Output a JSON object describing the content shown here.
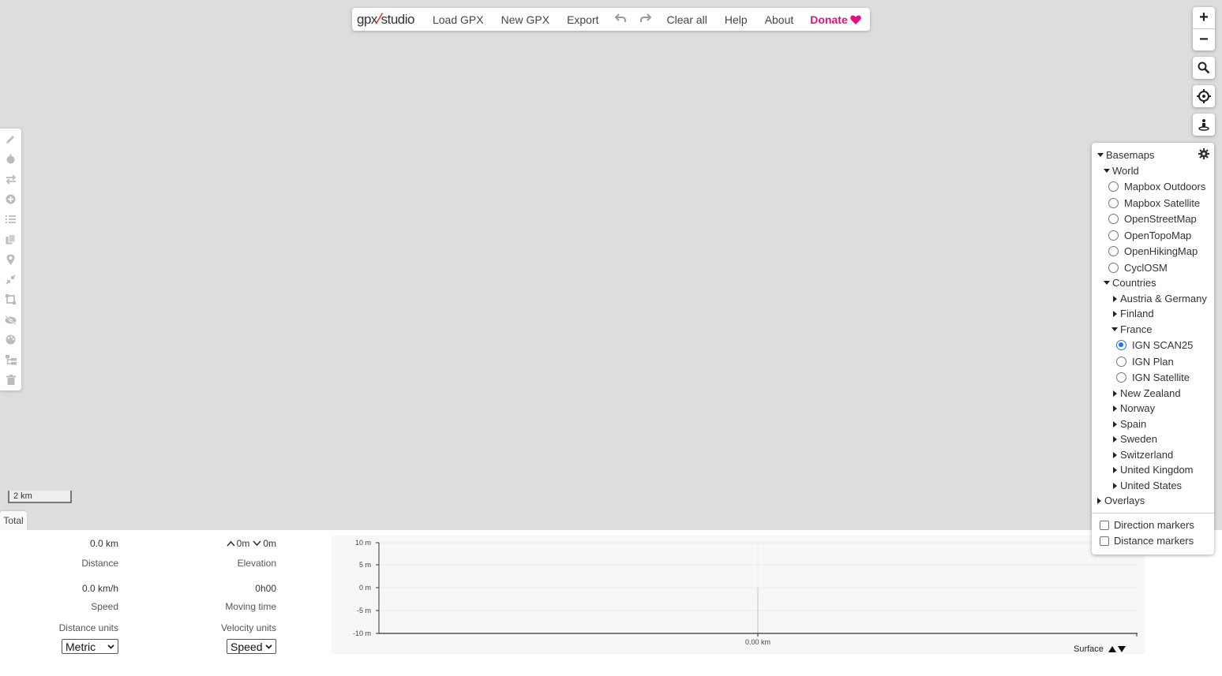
{
  "topbar": {
    "logo_left": "gpx",
    "logo_right": "studio",
    "load_gpx": "Load GPX",
    "new_gpx": "New GPX",
    "export": "Export",
    "clear_all": "Clear all",
    "help": "Help",
    "about": "About",
    "donate": "Donate"
  },
  "colors": {
    "donate": "#e0117f",
    "logo_slash": "#e43c1f",
    "radio_selected": "#1a73e8"
  },
  "map": {
    "scale_label": "2 km",
    "total_tab": "Total"
  },
  "stats": {
    "distance_value": "0.0 km",
    "distance_label": "Distance",
    "elevation_up": "0m",
    "elevation_down": "0m",
    "elevation_label": "Elevation",
    "speed_value": "0.0 km/h",
    "speed_label": "Speed",
    "moving_time_value": "0h00",
    "moving_time_label": "Moving time",
    "distance_units_label": "Distance units",
    "distance_units_value": "Metric",
    "velocity_units_label": "Velocity units",
    "velocity_units_value": "Speed"
  },
  "chart": {
    "y_ticks": [
      "10 m",
      "5 m",
      "0 m",
      "-5 m",
      "-10 m"
    ],
    "x_tick": "0.00 km",
    "surface_label": "Surface"
  },
  "layers": {
    "basemaps": "Basemaps",
    "world": "World",
    "world_items": [
      "Mapbox Outdoors",
      "Mapbox Satellite",
      "OpenStreetMap",
      "OpenTopoMap",
      "OpenHikingMap",
      "CyclOSM"
    ],
    "countries": "Countries",
    "austria_germany": "Austria & Germany",
    "finland": "Finland",
    "france": "France",
    "france_items": [
      "IGN SCAN25",
      "IGN Plan",
      "IGN Satellite"
    ],
    "france_selected": "IGN SCAN25",
    "other_countries": [
      "New Zealand",
      "Norway",
      "Spain",
      "Sweden",
      "Switzerland",
      "United Kingdom",
      "United States"
    ],
    "overlays": "Overlays",
    "direction_markers": "Direction markers",
    "distance_markers": "Distance markers"
  }
}
